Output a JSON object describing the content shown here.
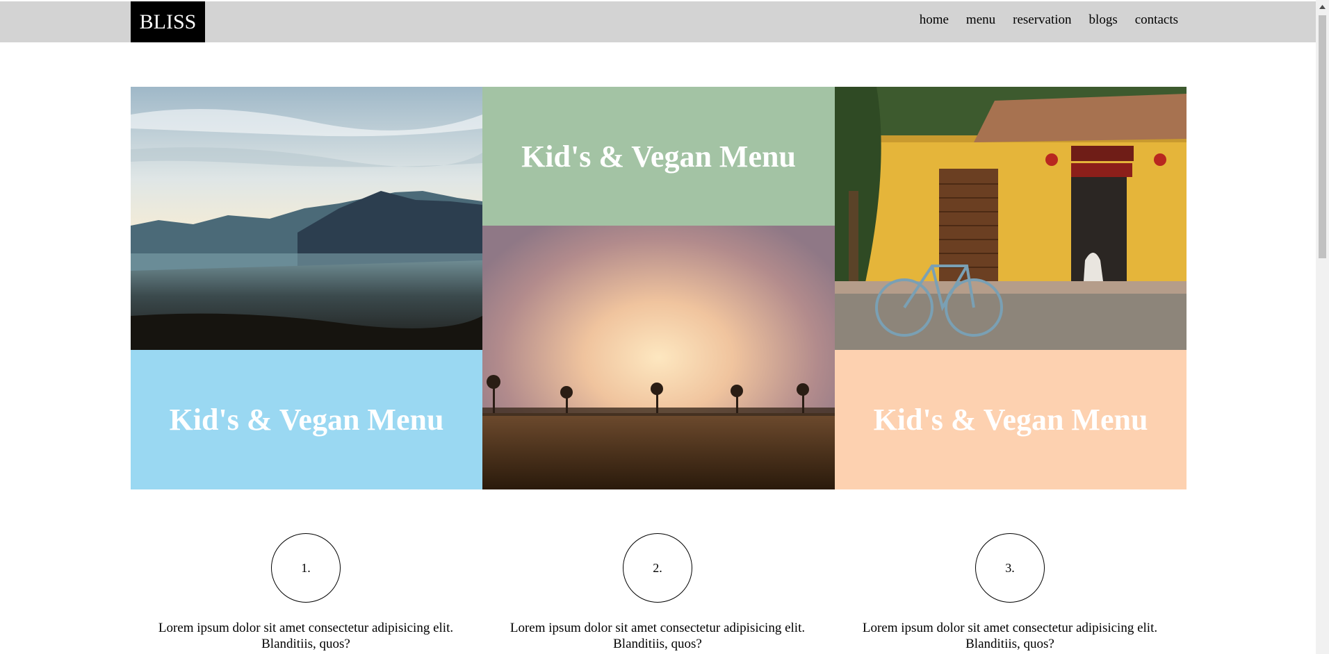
{
  "header": {
    "logo": "BLISS",
    "nav": [
      {
        "label": "home"
      },
      {
        "label": "menu"
      },
      {
        "label": "reservation"
      },
      {
        "label": "blogs"
      },
      {
        "label": "contacts"
      }
    ]
  },
  "tiles": {
    "top_middle": "Kid's & Vegan Menu",
    "bottom_left": "Kid's & Vegan Menu",
    "bottom_right": "Kid's & Vegan Menu"
  },
  "colors": {
    "header_bg": "#d3d3d3",
    "logo_bg": "#000000",
    "tile_green": "#a3c3a4",
    "tile_blue": "#9ad8f2",
    "tile_peach": "#fdd1b0"
  },
  "steps": [
    {
      "number": "1.",
      "text": "Lorem ipsum dolor sit amet consectetur adipisicing elit. Blanditiis, quos?"
    },
    {
      "number": "2.",
      "text": "Lorem ipsum dolor sit amet consectetur adipisicing elit. Blanditiis, quos?"
    },
    {
      "number": "3.",
      "text": "Lorem ipsum dolor sit amet consectetur adipisicing elit. Blanditiis, quos?"
    }
  ],
  "scrollbar": {
    "icon": "chevron-up-icon"
  }
}
